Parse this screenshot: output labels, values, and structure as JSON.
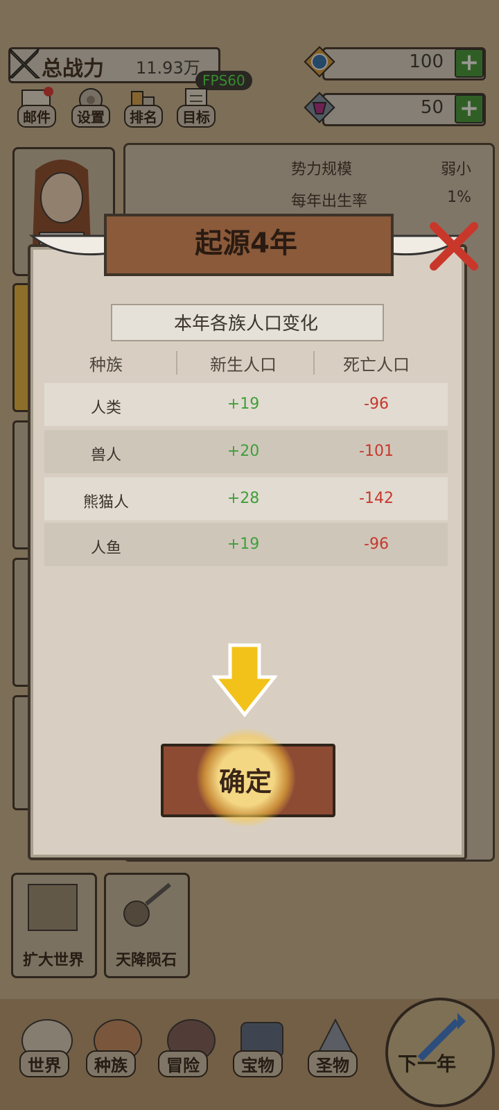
{
  "top": {
    "power_label": "总战力",
    "power_value": "11.93万",
    "fps": "FPS60",
    "resource1": "100",
    "resource2": "50",
    "menu": [
      "邮件",
      "设置",
      "排名",
      "目标"
    ]
  },
  "info_panel": {
    "rows": [
      {
        "label": "势力规模",
        "value": "弱小"
      },
      {
        "label": "每年出生率",
        "value": "1%"
      }
    ]
  },
  "skills": [
    "扩大世界",
    "天降陨石"
  ],
  "nav": [
    "世界",
    "种族",
    "冒险",
    "宝物",
    "圣物",
    "下一年"
  ],
  "dialog": {
    "title": "起源4年",
    "subtitle": "本年各族人口变化",
    "headers": [
      "种族",
      "新生人口",
      "死亡人口"
    ],
    "rows": [
      {
        "race": "人类",
        "born": "+19",
        "dead": "-96"
      },
      {
        "race": "兽人",
        "born": "+20",
        "dead": "-101"
      },
      {
        "race": "熊猫人",
        "born": "+28",
        "dead": "-142"
      },
      {
        "race": "人鱼",
        "born": "+19",
        "dead": "-96"
      }
    ],
    "confirm": "确定"
  },
  "colors": {
    "born": "#3f9f3a",
    "dead": "#c6382d",
    "accent": "#f2c21b"
  }
}
